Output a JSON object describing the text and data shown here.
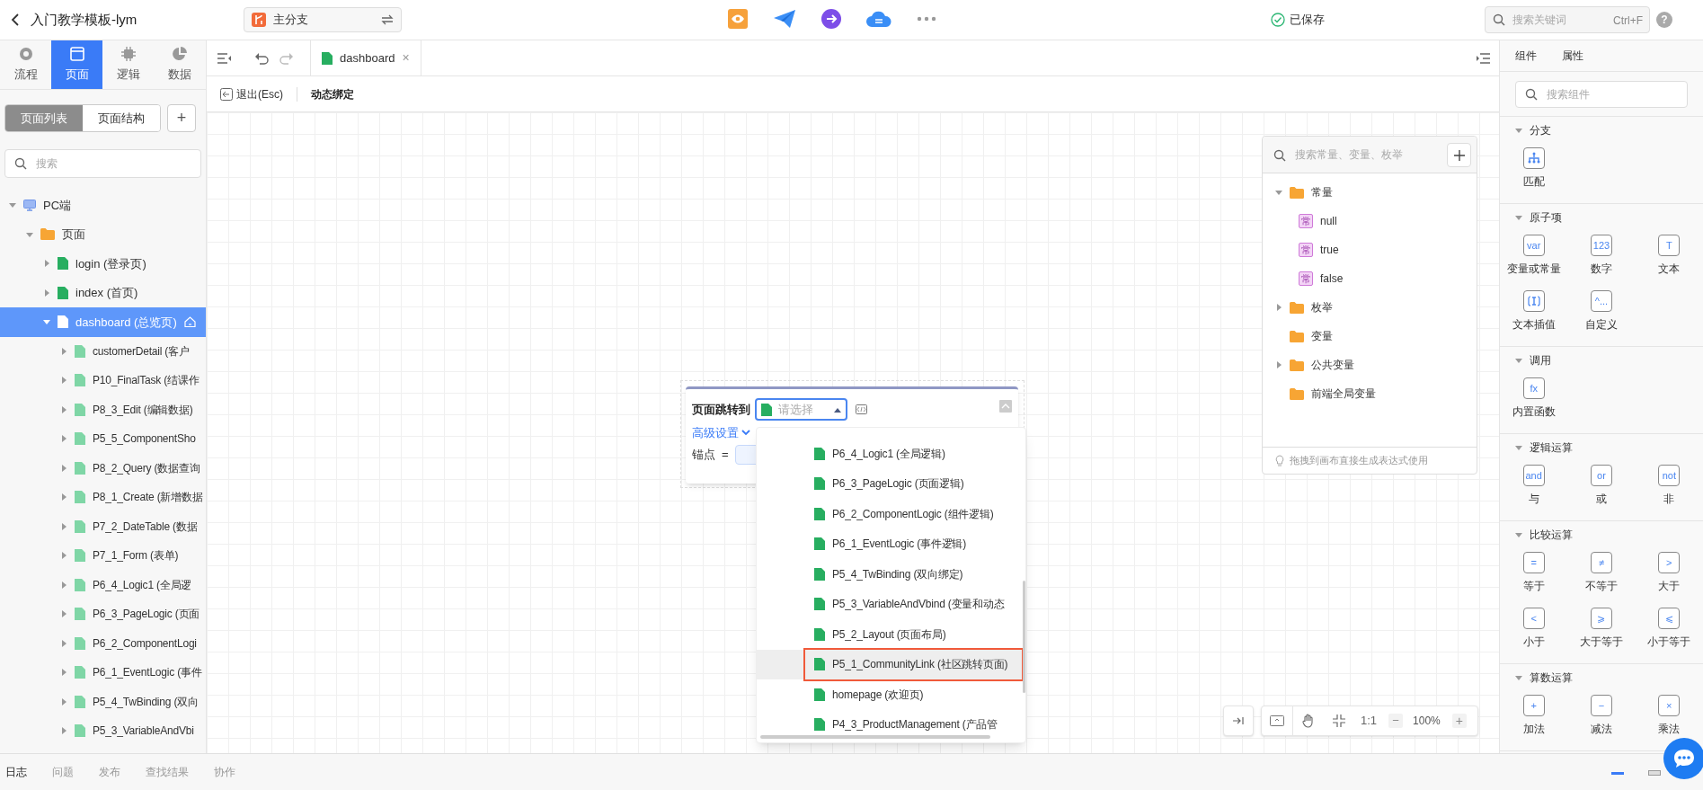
{
  "top_bar": {
    "title": "入门教学模板-lym",
    "branch": "主分支",
    "save_status": "已保存",
    "search": {
      "placeholder": "搜索关键词",
      "shortcut": "Ctrl+F"
    },
    "help": "?"
  },
  "side_nav": [
    {
      "label": "流程",
      "kind": "flow",
      "selected": false
    },
    {
      "label": "页面",
      "kind": "page",
      "selected": true
    },
    {
      "label": "逻辑",
      "kind": "logic",
      "selected": false
    },
    {
      "label": "数据",
      "kind": "data",
      "selected": false
    }
  ],
  "page_panel": {
    "view_tabs": [
      {
        "label": "页面列表",
        "selected": true
      },
      {
        "label": "页面结构",
        "selected": false
      }
    ],
    "add_button": "+",
    "search": {
      "placeholder": "搜索"
    },
    "tree": [
      {
        "label": "PC端",
        "kind": "device",
        "expanded": true,
        "children": [
          {
            "label": "页面",
            "kind": "folder",
            "expanded": true,
            "children": [
              {
                "label": "login (登录页)",
                "kind": "page",
                "expanded": false,
                "selected": false,
                "home": false
              },
              {
                "label": "index (首页)",
                "kind": "page",
                "expanded": false,
                "selected": false,
                "home": false
              },
              {
                "label": "dashboard (总览页)",
                "kind": "page",
                "expanded": true,
                "selected": true,
                "home": true,
                "children": [
                  {
                    "label": "customerDetail (客户",
                    "kind": "page",
                    "expanded": false,
                    "selected": false,
                    "home": false
                  },
                  {
                    "label": "P10_FinalTask (结课作",
                    "kind": "page",
                    "expanded": false,
                    "selected": false,
                    "home": false
                  },
                  {
                    "label": "P8_3_Edit (编辑数据)",
                    "kind": "page",
                    "expanded": false,
                    "selected": false,
                    "home": false
                  },
                  {
                    "label": "P5_5_ComponentSho",
                    "kind": "page",
                    "expanded": false,
                    "selected": false,
                    "home": false
                  },
                  {
                    "label": "P8_2_Query (数据查询",
                    "kind": "page",
                    "expanded": false,
                    "selected": false,
                    "home": false
                  },
                  {
                    "label": "P8_1_Create (新增数据",
                    "kind": "page",
                    "expanded": false,
                    "selected": false,
                    "home": false
                  },
                  {
                    "label": "P7_2_DateTable (数据",
                    "kind": "page",
                    "expanded": false,
                    "selected": false,
                    "home": false
                  },
                  {
                    "label": "P7_1_Form (表单)",
                    "kind": "page",
                    "expanded": false,
                    "selected": false,
                    "home": false
                  },
                  {
                    "label": "P6_4_Logic1 (全局逻",
                    "kind": "page",
                    "expanded": false,
                    "selected": false,
                    "home": false
                  },
                  {
                    "label": "P6_3_PageLogic (页面",
                    "kind": "page",
                    "expanded": false,
                    "selected": false,
                    "home": false
                  },
                  {
                    "label": "P6_2_ComponentLogi",
                    "kind": "page",
                    "expanded": false,
                    "selected": false,
                    "home": false
                  },
                  {
                    "label": "P6_1_EventLogic (事件",
                    "kind": "page",
                    "expanded": false,
                    "selected": false,
                    "home": false
                  },
                  {
                    "label": "P5_4_TwBinding (双向",
                    "kind": "page",
                    "expanded": false,
                    "selected": false,
                    "home": false
                  },
                  {
                    "label": "P5_3_VariableAndVbi",
                    "kind": "page",
                    "expanded": false,
                    "selected": false,
                    "home": false
                  }
                ]
              }
            ]
          }
        ]
      }
    ]
  },
  "editor": {
    "tabs": [
      {
        "label": "dashboard",
        "close": "×"
      }
    ],
    "exit_button": "退出(Esc)",
    "mode_label": "动态绑定"
  },
  "jump_card": {
    "label": "页面跳转到",
    "select": {
      "placeholder": "请选择",
      "open": true
    },
    "advanced": "高级设置",
    "anchor_label": "锚点",
    "equals": "="
  },
  "dropdown": {
    "options": [
      {
        "label": "P6_4_Logic1 (全局逻辑)",
        "selected": false
      },
      {
        "label": "P6_3_PageLogic (页面逻辑)",
        "selected": false
      },
      {
        "label": "P6_2_ComponentLogic (组件逻辑)",
        "selected": false
      },
      {
        "label": "P6_1_EventLogic (事件逻辑)",
        "selected": false
      },
      {
        "label": "P5_4_TwBinding (双向绑定)",
        "selected": false
      },
      {
        "label": "P5_3_VariableAndVbind (变量和动态",
        "selected": false
      },
      {
        "label": "P5_2_Layout (页面布局)",
        "selected": false
      },
      {
        "label": "P5_1_CommunityLink (社区跳转页面)",
        "selected": true
      },
      {
        "label": "homepage (欢迎页)",
        "selected": false
      },
      {
        "label": "P4_3_ProductManagement (产品管",
        "selected": false
      }
    ]
  },
  "variables": {
    "search": {
      "placeholder": "搜索常量、变量、枚举"
    },
    "tree": [
      {
        "label": "常量",
        "kind": "folder",
        "expanded": true,
        "children": [
          {
            "label": "null",
            "kind": "constant",
            "badge": "常"
          },
          {
            "label": "true",
            "kind": "constant",
            "badge": "常"
          },
          {
            "label": "false",
            "kind": "constant",
            "badge": "常"
          }
        ]
      },
      {
        "label": "枚举",
        "kind": "folder",
        "expanded": false
      },
      {
        "label": "变量",
        "kind": "folder"
      },
      {
        "label": "公共变量",
        "kind": "folder",
        "expanded": false
      },
      {
        "label": "前端全局变量",
        "kind": "folder"
      }
    ],
    "hint": "拖拽到画布直接生成表达式使用"
  },
  "zoom": {
    "actual_size": "1:1",
    "zoom_out": "−",
    "level_text": "100%",
    "zoom_in": "+"
  },
  "components": {
    "tabs": [
      {
        "label": "组件"
      },
      {
        "label": "属性"
      }
    ],
    "search": {
      "placeholder": "搜索组件"
    },
    "sections": [
      {
        "title": "分支",
        "items": [
          {
            "label": "匹配",
            "kind": "branch"
          }
        ]
      },
      {
        "title": "原子项",
        "items": [
          {
            "label": "变量或常量",
            "glyph": "var"
          },
          {
            "label": "数字",
            "glyph": "123"
          },
          {
            "label": "文本",
            "glyph": "T"
          },
          {
            "label": "文本插值",
            "kind": "interpolate"
          },
          {
            "label": "自定义",
            "glyph": "^..."
          }
        ]
      },
      {
        "title": "调用",
        "items": [
          {
            "label": "内置函数",
            "glyph": "fx"
          }
        ]
      },
      {
        "title": "逻辑运算",
        "items": [
          {
            "label": "与",
            "glyph": "and"
          },
          {
            "label": "或",
            "glyph": "or"
          },
          {
            "label": "非",
            "glyph": "not"
          }
        ]
      },
      {
        "title": "比较运算",
        "items": [
          {
            "label": "等于",
            "glyph": "="
          },
          {
            "label": "不等于",
            "glyph": "≠"
          },
          {
            "label": "大于",
            "glyph": ">"
          },
          {
            "label": "小于",
            "glyph": "<"
          },
          {
            "label": "大于等于",
            "glyph": "⩾"
          },
          {
            "label": "小于等于",
            "glyph": "⩽"
          }
        ]
      },
      {
        "title": "算数运算",
        "items": [
          {
            "label": "加法",
            "glyph": "+"
          },
          {
            "label": "减法",
            "glyph": "−"
          },
          {
            "label": "乘法",
            "glyph": "×"
          }
        ]
      }
    ]
  },
  "bottom_bar": {
    "tabs": [
      {
        "label": "日志",
        "selected": true
      },
      {
        "label": "问题",
        "selected": false
      },
      {
        "label": "发布",
        "selected": false
      },
      {
        "label": "查找结果",
        "selected": false
      },
      {
        "label": "协作",
        "selected": false
      }
    ]
  }
}
